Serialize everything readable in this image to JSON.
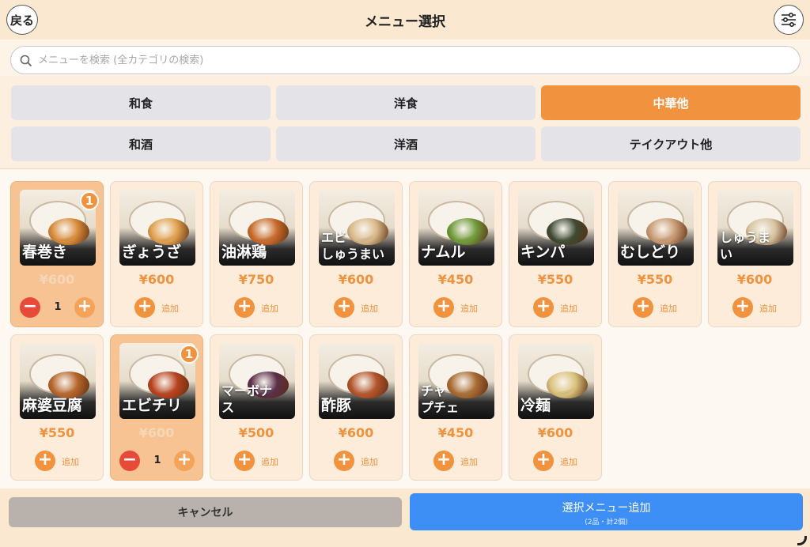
{
  "header": {
    "back_label": "戻る",
    "title": "メニュー選択",
    "settings_icon": "sliders-icon"
  },
  "search": {
    "placeholder": "メニューを検索 (全カテゴリの検索)",
    "value": ""
  },
  "categories": [
    {
      "label": "和食",
      "active": false
    },
    {
      "label": "洋食",
      "active": false
    },
    {
      "label": "中華他",
      "active": true
    },
    {
      "label": "和酒",
      "active": false
    },
    {
      "label": "洋酒",
      "active": false
    },
    {
      "label": "テイクアウト他",
      "active": false
    }
  ],
  "items": [
    {
      "name": "春巻き",
      "price": "¥600",
      "qty": 1,
      "badge": "1",
      "food_color": "#d98b3a"
    },
    {
      "name": "ぎょうざ",
      "price": "¥600",
      "qty": 0,
      "food_color": "#e0a14f"
    },
    {
      "name": "油淋鶏",
      "price": "¥750",
      "qty": 0,
      "food_color": "#c96a2b"
    },
    {
      "name": "エビ\nしゅうまい",
      "price": "¥600",
      "qty": 0,
      "food_color": "#d8b989"
    },
    {
      "name": "ナムル",
      "price": "¥450",
      "qty": 0,
      "food_color": "#6f9a3a"
    },
    {
      "name": "キンパ",
      "price": "¥550",
      "qty": 0,
      "food_color": "#3e4a32"
    },
    {
      "name": "むしどり",
      "price": "¥550",
      "qty": 0,
      "food_color": "#c89a74"
    },
    {
      "name": "しゅうま\nい",
      "price": "¥600",
      "qty": 0,
      "food_color": "#d6c3a0"
    },
    {
      "name": "麻婆豆腐",
      "price": "¥550",
      "qty": 0,
      "food_color": "#b5652b"
    },
    {
      "name": "エビチリ",
      "price": "¥600",
      "qty": 1,
      "badge": "1",
      "food_color": "#b8421f"
    },
    {
      "name": "マーボナ\nス",
      "price": "¥500",
      "qty": 0,
      "food_color": "#5c2f4a"
    },
    {
      "name": "酢豚",
      "price": "¥600",
      "qty": 0,
      "food_color": "#b3542a"
    },
    {
      "name": "チャ\nプチェ",
      "price": "¥450",
      "qty": 0,
      "food_color": "#a86b33"
    },
    {
      "name": "冷麺",
      "price": "¥600",
      "qty": 0,
      "food_color": "#d9c07a"
    }
  ],
  "labels": {
    "add": "追加",
    "plus": "+",
    "minus": "−"
  },
  "footer": {
    "cancel_label": "キャンセル",
    "confirm_label": "選択メニュー追加",
    "confirm_sub": "(2品・計2個)"
  },
  "colors": {
    "accent": "#f0923e",
    "confirm": "#3d8ef5",
    "minus": "#e84a3a"
  }
}
